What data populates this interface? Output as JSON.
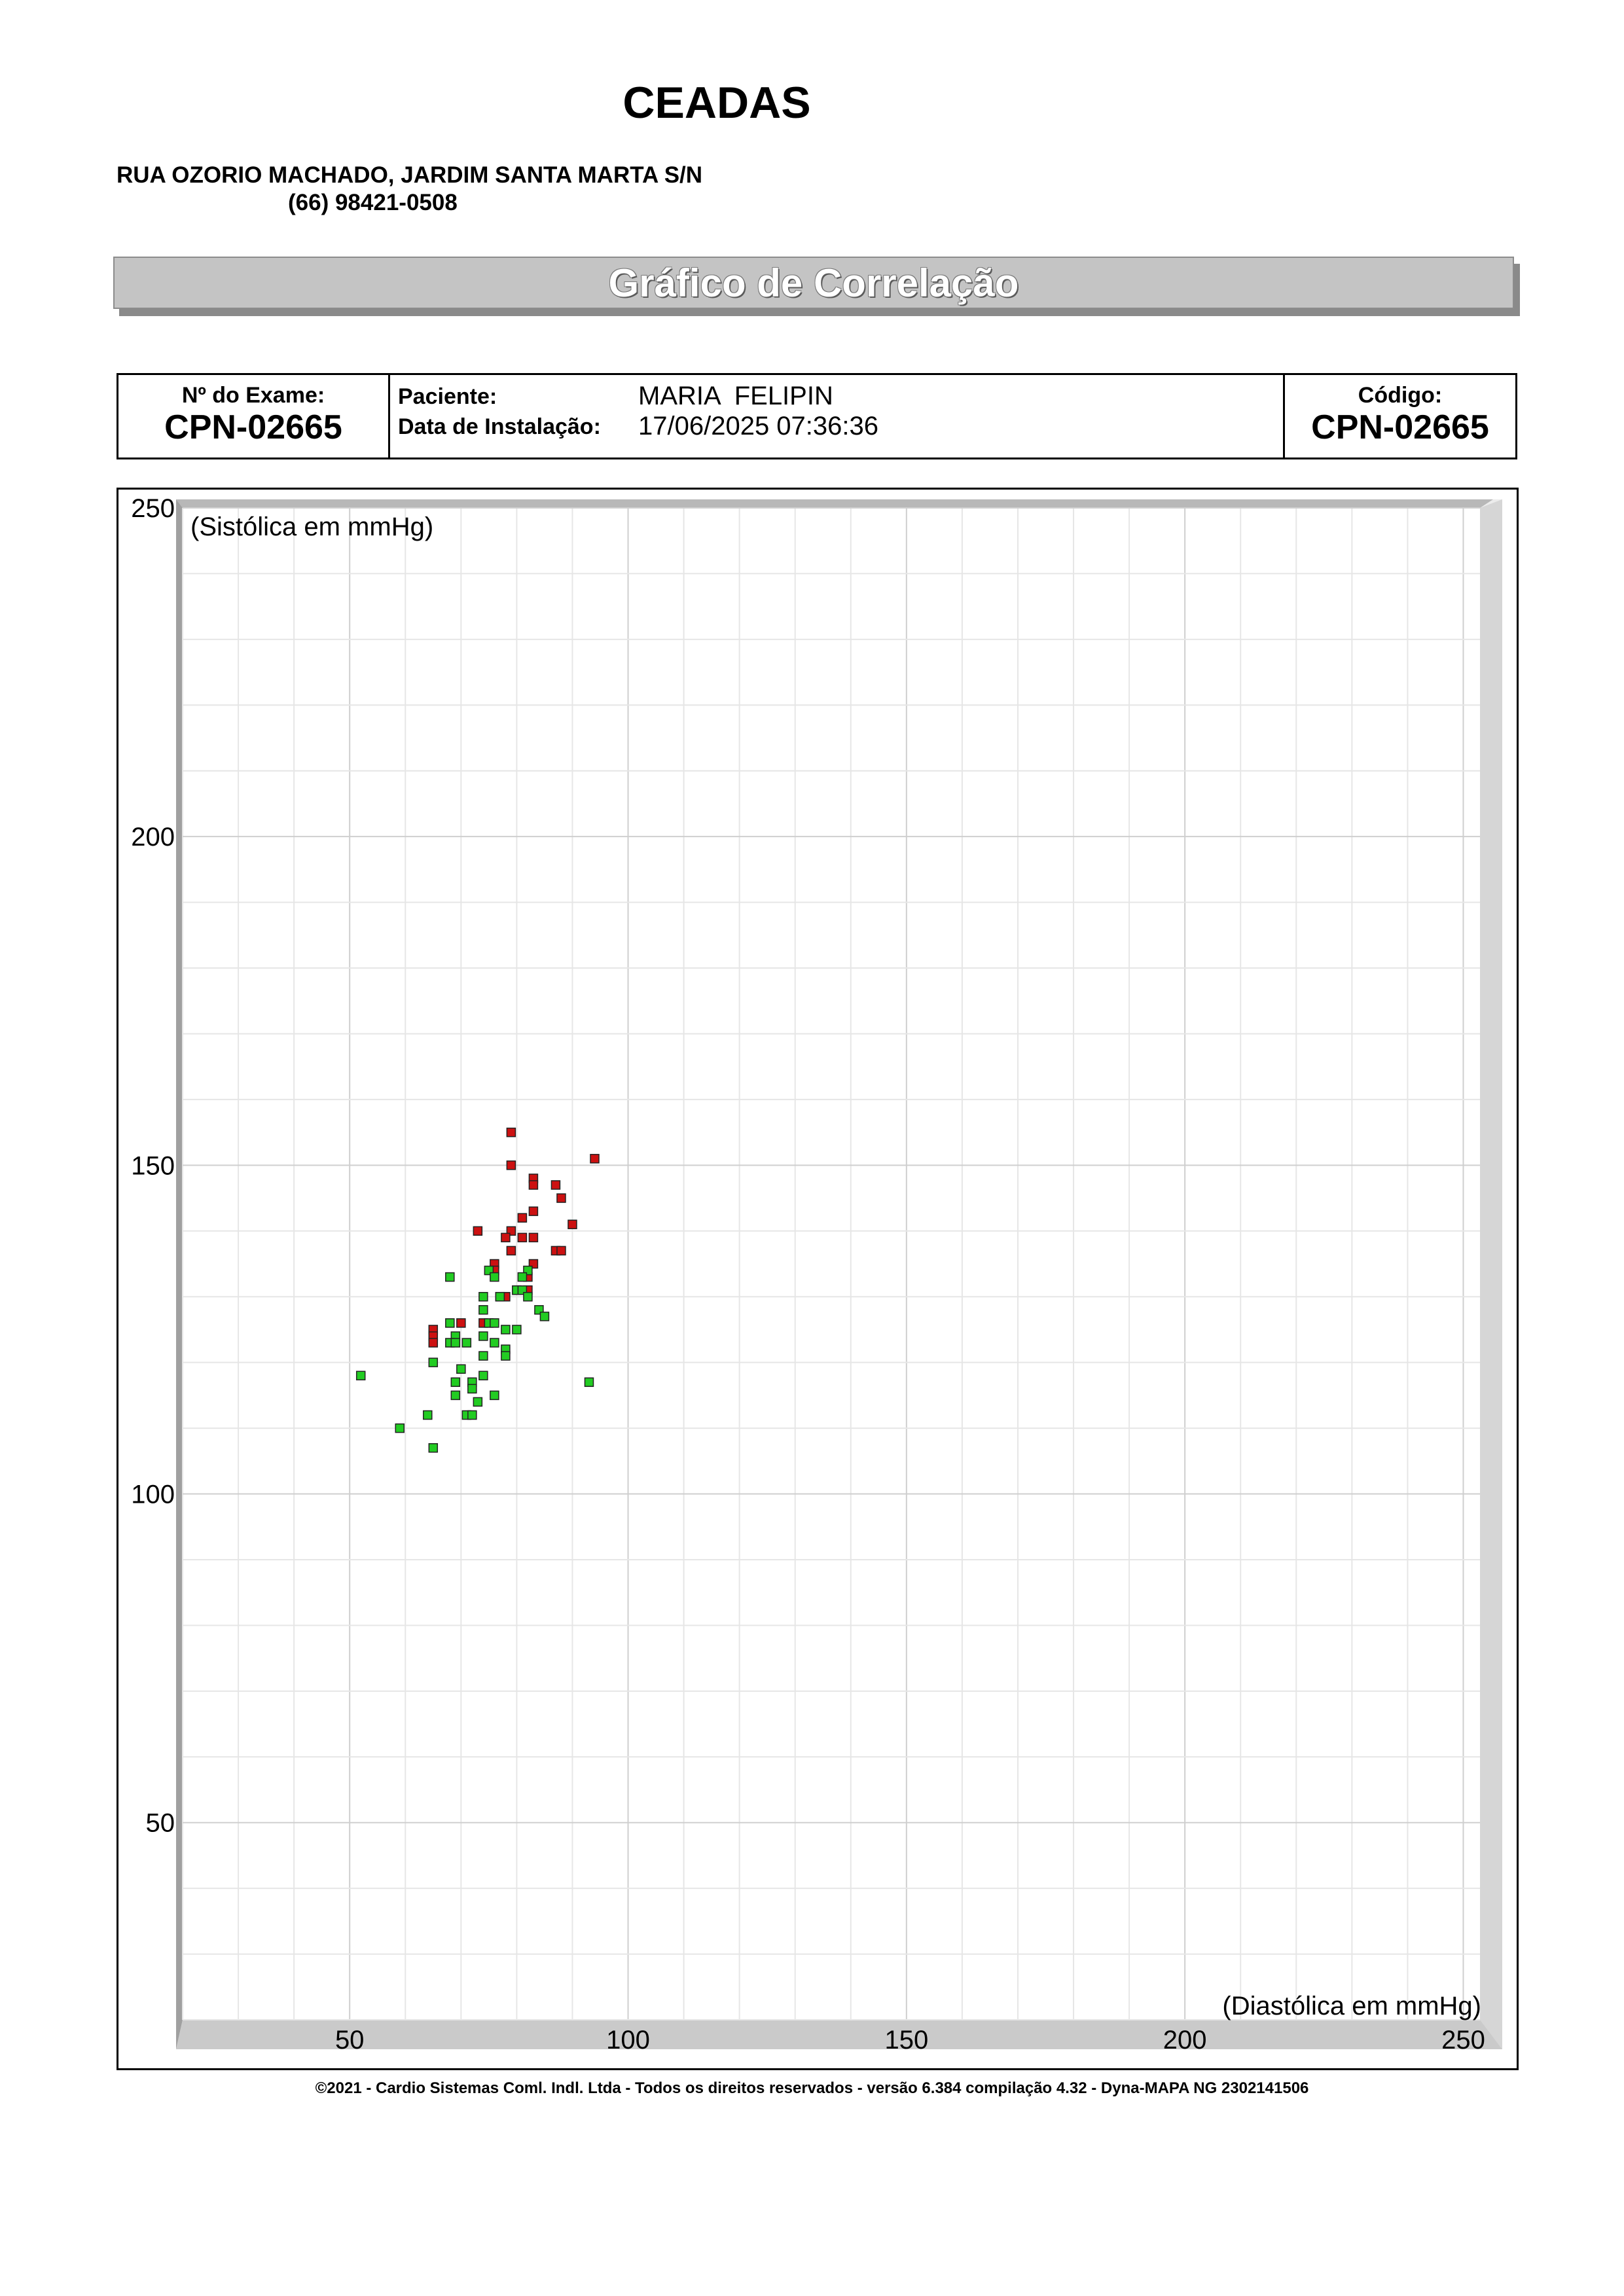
{
  "header": {
    "org_name": "CEADAS",
    "address": "RUA OZORIO MACHADO, JARDIM SANTA MARTA S/N",
    "phone": "(66) 98421-0508"
  },
  "title_bar": {
    "title": "Gráfico de Correlação"
  },
  "info": {
    "exam_label": "Nº do Exame:",
    "exam_value": "CPN-02665",
    "patient_label": "Paciente:",
    "patient_value": "MARIA  FELIPIN",
    "install_label": "Data de Instalação:",
    "install_value": "17/06/2025 07:36:36",
    "code_label": "Código:",
    "code_value": "CPN-02665"
  },
  "chart_data": {
    "type": "scatter",
    "xlabel": "(Diastólica em mmHg)",
    "ylabel": "(Sistólica em mmHg)",
    "xlim": [
      20,
      253
    ],
    "ylim": [
      20,
      250
    ],
    "x_ticks": [
      50,
      100,
      150,
      200,
      250
    ],
    "y_ticks": [
      50,
      100,
      150,
      200,
      250
    ],
    "grid": true,
    "series": [
      {
        "color": "#cc1111",
        "points": [
          [
            79,
            155
          ],
          [
            94,
            151
          ],
          [
            79,
            150
          ],
          [
            83,
            148
          ],
          [
            83,
            147
          ],
          [
            87,
            147
          ],
          [
            88,
            145
          ],
          [
            83,
            143
          ],
          [
            81,
            142
          ],
          [
            90,
            141
          ],
          [
            73,
            140
          ],
          [
            79,
            140
          ],
          [
            78,
            139
          ],
          [
            81,
            139
          ],
          [
            83,
            139
          ],
          [
            79,
            137
          ],
          [
            87,
            137
          ],
          [
            88,
            137
          ],
          [
            76,
            135
          ],
          [
            83,
            135
          ],
          [
            76,
            134
          ],
          [
            82,
            133
          ],
          [
            80,
            131
          ],
          [
            82,
            131
          ],
          [
            77,
            130
          ],
          [
            78,
            130
          ],
          [
            70,
            126
          ],
          [
            74,
            126
          ],
          [
            65,
            125
          ],
          [
            65,
            124
          ],
          [
            65,
            123
          ]
        ]
      },
      {
        "color": "#22cc22",
        "points": [
          [
            75,
            134
          ],
          [
            82,
            134
          ],
          [
            68,
            133
          ],
          [
            76,
            133
          ],
          [
            81,
            133
          ],
          [
            80,
            131
          ],
          [
            81,
            131
          ],
          [
            74,
            130
          ],
          [
            82,
            130
          ],
          [
            77,
            130
          ],
          [
            74,
            128
          ],
          [
            84,
            128
          ],
          [
            85,
            127
          ],
          [
            68,
            126
          ],
          [
            75,
            126
          ],
          [
            76,
            126
          ],
          [
            78,
            125
          ],
          [
            80,
            125
          ],
          [
            74,
            124
          ],
          [
            69,
            124
          ],
          [
            68,
            123
          ],
          [
            69,
            123
          ],
          [
            71,
            123
          ],
          [
            76,
            123
          ],
          [
            78,
            122
          ],
          [
            74,
            121
          ],
          [
            78,
            121
          ],
          [
            65,
            120
          ],
          [
            70,
            119
          ],
          [
            52,
            118
          ],
          [
            74,
            118
          ],
          [
            69,
            117
          ],
          [
            72,
            117
          ],
          [
            93,
            117
          ],
          [
            72,
            116
          ],
          [
            69,
            115
          ],
          [
            76,
            115
          ],
          [
            73,
            114
          ],
          [
            64,
            112
          ],
          [
            71,
            112
          ],
          [
            72,
            112
          ],
          [
            59,
            110
          ],
          [
            65,
            107
          ]
        ]
      }
    ]
  },
  "footer": {
    "text": "©2021 - Cardio Sistemas Coml. Indl. Ltda - Todos os direitos reservados - versão 6.384 compilação 4.32 - Dyna-MAPA NG 2302141506"
  }
}
